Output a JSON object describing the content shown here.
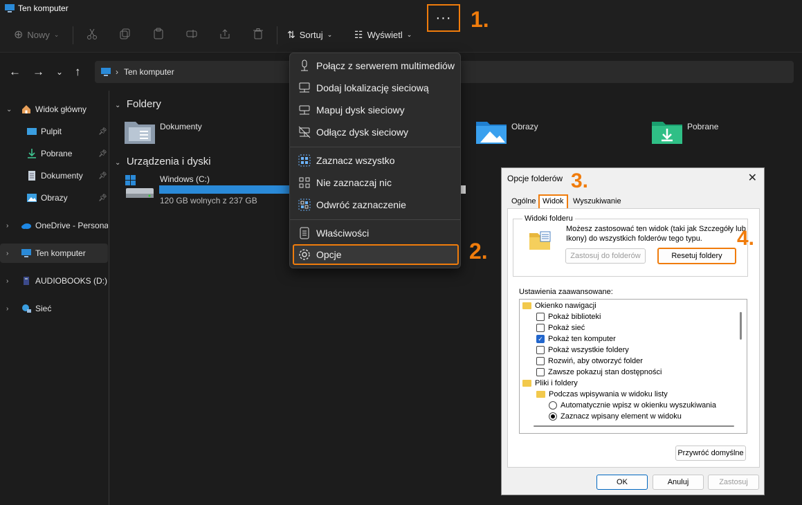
{
  "window": {
    "title": "Ten komputer"
  },
  "toolbar": {
    "new_label": "Nowy",
    "sort_label": "Sortuj",
    "view_label": "Wyświetl",
    "more_label": "···"
  },
  "nav": {
    "breadcrumb": "Ten komputer"
  },
  "sidebar": {
    "home": "Widok główny",
    "quick": [
      {
        "label": "Pulpit"
      },
      {
        "label": "Pobrane"
      },
      {
        "label": "Dokumenty"
      },
      {
        "label": "Obrazy"
      }
    ],
    "onedrive": "OneDrive - Personal",
    "this_pc": "Ten komputer",
    "audiobooks": "AUDIOBOOKS (D:)",
    "network": "Sieć"
  },
  "content": {
    "folders_title": "Foldery",
    "folders": [
      {
        "label": "Dokumenty"
      },
      {
        "label": "Obrazy"
      },
      {
        "label": "Pobrane"
      }
    ],
    "drives_title": "Urządzenia i dyski",
    "drive": {
      "label": "Windows (C:)",
      "free": "120 GB wolnych z 237 GB",
      "used_fraction": 0.49
    }
  },
  "menu": {
    "items": [
      {
        "label": "Połącz z serwerem multimediów"
      },
      {
        "label": "Dodaj lokalizację sieciową"
      },
      {
        "label": "Mapuj dysk sieciowy"
      },
      {
        "label": "Odłącz dysk sieciowy"
      },
      {
        "label": "Zaznacz wszystko"
      },
      {
        "label": "Nie zaznaczaj nic"
      },
      {
        "label": "Odwróć zaznaczenie"
      },
      {
        "label": "Właściwości"
      },
      {
        "label": "Opcje"
      }
    ]
  },
  "annotations": {
    "a1": "1.",
    "a2": "2.",
    "a3": "3.",
    "a4": "4."
  },
  "dialog": {
    "title": "Opcje folderów",
    "tabs": [
      "Ogólne",
      "Widok",
      "Wyszukiwanie"
    ],
    "group_title": "Widoki folderu",
    "group_text": "Możesz zastosować ten widok (taki jak Szczegóły lub Ikony) do wszystkich folderów tego typu.",
    "apply_folders": "Zastosuj do folderów",
    "reset_folders": "Resetuj foldery",
    "advanced_label": "Ustawienia zaawansowane:",
    "tree": [
      "Okienko nawigacji",
      "Pokaż biblioteki",
      "Pokaż sieć",
      "Pokaż ten komputer",
      "Pokaż wszystkie foldery",
      "Rozwiń, aby otworzyć folder",
      "Zawsze pokazuj stan dostępności",
      "Pliki i foldery",
      "Podczas wpisywania w widoku listy",
      "Automatycznie wpisz w okienku wyszukiwania",
      "Zaznacz wpisany element w widoku"
    ],
    "restore_defaults": "Przywróć domyślne",
    "ok": "OK",
    "cancel": "Anuluj",
    "apply": "Zastosuj"
  },
  "colors": {
    "accent_orange": "#f07c0c",
    "windows_blue": "#2a8ad8",
    "drive_bar": "#2a8ad8"
  }
}
